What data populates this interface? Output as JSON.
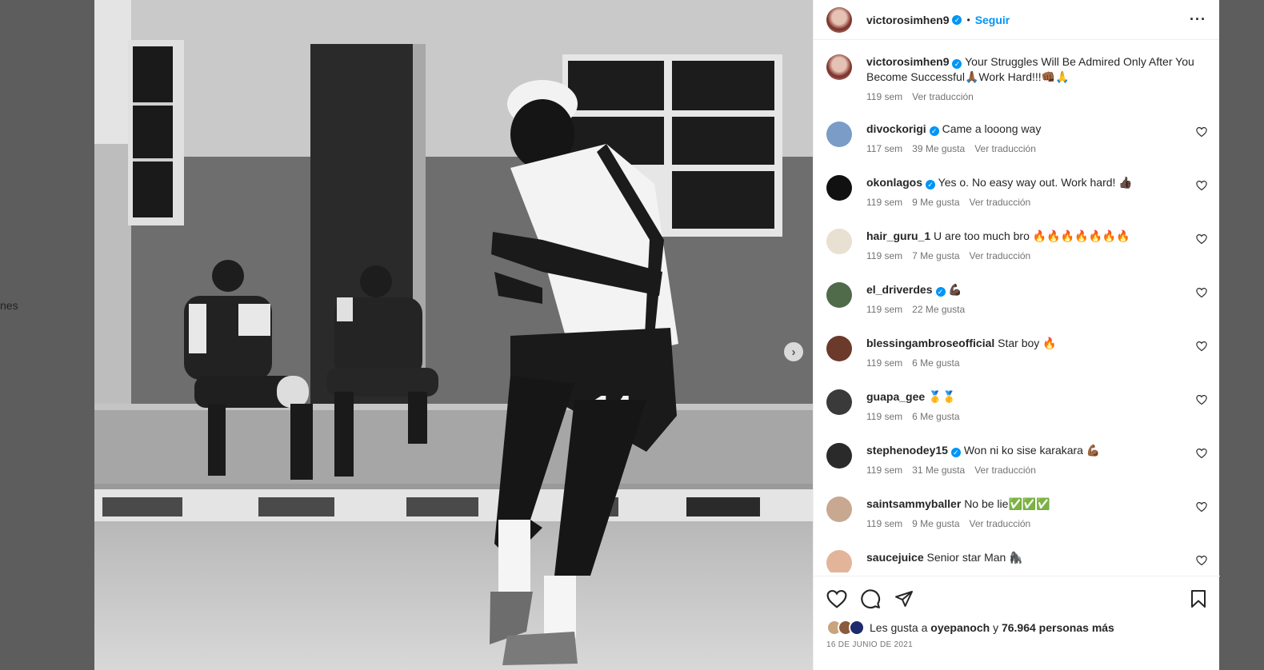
{
  "background": {
    "edge_text": "nes"
  },
  "header": {
    "username": "victorosimhen9",
    "separator": "•",
    "follow_label": "Seguir",
    "more_label": "···"
  },
  "caption": {
    "username": "victorosimhen9",
    "text": "Your Struggles Will Be Admired Only After You Become Successful🙏🏾Work Hard!!!👊🏾🙏",
    "time": "119 sem",
    "translate": "Ver traducción"
  },
  "comments": [
    {
      "username": "divockorigi",
      "verified": true,
      "text": "Came a looong way",
      "time": "117 sem",
      "likes": "39 Me gusta",
      "translate": "Ver traducción",
      "avatar_color": "#7a9cc6"
    },
    {
      "username": "okonlagos",
      "verified": true,
      "text": "Yes o. No easy way out. Work hard! 👍🏿",
      "time": "119 sem",
      "likes": "9 Me gusta",
      "translate": "Ver traducción",
      "avatar_color": "#111111"
    },
    {
      "username": "hair_guru_1",
      "verified": false,
      "text": "U are too much bro 🔥🔥🔥🔥🔥🔥🔥",
      "time": "119 sem",
      "likes": "7 Me gusta",
      "translate": "Ver traducción",
      "avatar_color": "#e8e0d0"
    },
    {
      "username": "el_driverdes",
      "verified": true,
      "text": "💪🏿",
      "time": "119 sem",
      "likes": "22 Me gusta",
      "translate": "",
      "avatar_color": "#4f6b4a"
    },
    {
      "username": "blessingambroseofficial",
      "verified": false,
      "text": "Star boy 🔥",
      "time": "119 sem",
      "likes": "6 Me gusta",
      "translate": "",
      "avatar_color": "#6b3a2a"
    },
    {
      "username": "guapa_gee",
      "verified": false,
      "text": "🥇🥇",
      "time": "119 sem",
      "likes": "6 Me gusta",
      "translate": "",
      "avatar_color": "#3a3a3a"
    },
    {
      "username": "stephenodey15",
      "verified": true,
      "text": "Won ni ko sise karakara 💪🏾",
      "time": "119 sem",
      "likes": "31 Me gusta",
      "translate": "Ver traducción",
      "avatar_color": "#2a2a2a"
    },
    {
      "username": "saintsammyballer",
      "verified": false,
      "text": "No be lie✅✅✅",
      "time": "119 sem",
      "likes": "9 Me gusta",
      "translate": "Ver traducción",
      "avatar_color": "#c8a890"
    },
    {
      "username": "saucejuice",
      "verified": false,
      "text": "Senior star Man 🦍",
      "time": "",
      "likes": "",
      "translate": "",
      "avatar_color": "#e2b59a"
    }
  ],
  "likes": {
    "prefix": "Les gusta a",
    "user": "oyepanoch",
    "connector": "y",
    "others": "76.964 personas más"
  },
  "date": "16 DE JUNIO DE 2021",
  "icons": {
    "like": "heart-icon",
    "comment": "comment-icon",
    "share": "paper-plane-icon",
    "save": "bookmark-icon",
    "next": "chevron-right-icon"
  },
  "colors": {
    "accent": "#0095f6",
    "text": "#262626",
    "muted": "#737373"
  }
}
